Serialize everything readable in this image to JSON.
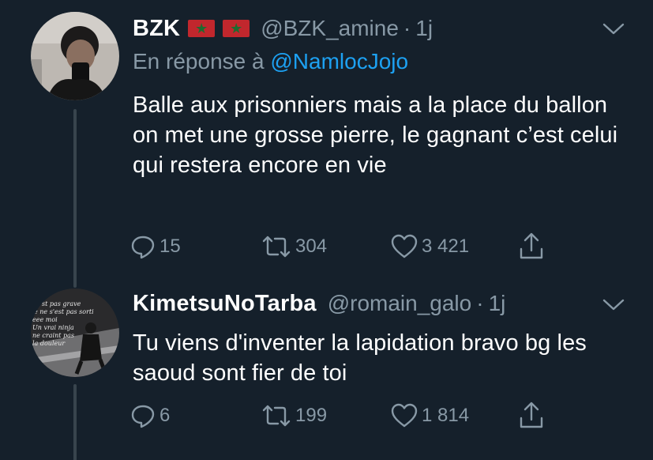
{
  "tweets": [
    {
      "display_name": "BZK",
      "flags": [
        "morocco-flag",
        "morocco-flag"
      ],
      "handle": "@BZK_amine",
      "separator": "·",
      "time": "1j",
      "reply_prefix": "En réponse à",
      "reply_to": "@NamlocJojo",
      "text": "Balle aux prisonniers mais a la place du ballon on met une grosse pierre, le gagnant c’est celui qui restera encore en vie",
      "replies": "15",
      "retweets": "304",
      "likes": "3 421"
    },
    {
      "display_name": "KimetsuNoTarba",
      "handle": "@romain_galo",
      "separator": "·",
      "time": "1j",
      "text": "Tu viens d'inventer la lapidation bravo bg les saoud sont fier de toi",
      "replies": "6",
      "retweets": "199",
      "likes": "1 814",
      "avatar_text": [
        "st pas grave",
        "e ne s'est pas sorti",
        "eee moi",
        "Un vrai ninja",
        "ne craint pas",
        "la douleur"
      ]
    }
  ],
  "colors": {
    "background": "#15202b",
    "secondary_text": "#8899a6",
    "link": "#1da1f2",
    "thread_line": "#38444d"
  }
}
